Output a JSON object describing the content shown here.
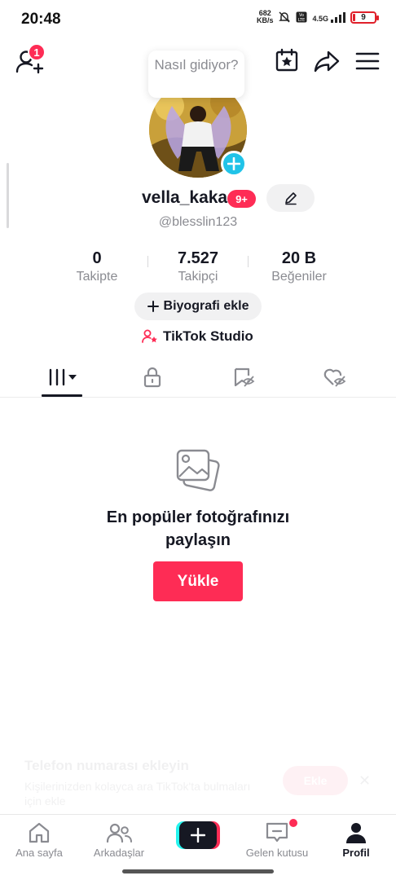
{
  "status_bar": {
    "time": "20:48",
    "net_speed_value": "682",
    "net_speed_unit": "KB/s",
    "network": "4.5G",
    "battery_level": "9",
    "battery_color": "#e0202a"
  },
  "top_bar": {
    "add_friend_badge": "1",
    "icons": [
      "add-friend-icon",
      "calendar-star-icon",
      "share-icon",
      "menu-icon"
    ]
  },
  "profile": {
    "status_bubble": "Nasıl gidiyor?",
    "username": "vella_kaka",
    "notification_badge": "9+",
    "handle": "@blesslin123"
  },
  "stats": [
    {
      "value": "0",
      "label": "Takipte"
    },
    {
      "value": "7.527",
      "label": "Takipçi"
    },
    {
      "value": "20 B",
      "label": "Beğeniler"
    }
  ],
  "actions": {
    "add_bio": "Biyografi ekle",
    "studio": "TikTok Studio"
  },
  "tabs": [
    "videos-grid-tab",
    "private-tab",
    "reposts-tab",
    "liked-tab"
  ],
  "empty_state": {
    "title": "En popüler fotoğrafınızı paylaşın",
    "upload_button": "Yükle"
  },
  "phone_banner": {
    "title": "Telefon numarası ekleyin",
    "description": "Kişilerinizden kolayca ara TikTok'ta bulmaları için ekle",
    "button": "Ekle"
  },
  "bottom_nav": [
    {
      "label": "Ana sayfa",
      "icon": "home-icon"
    },
    {
      "label": "Arkadaşlar",
      "icon": "friends-icon"
    },
    {
      "label": "",
      "icon": "create-icon"
    },
    {
      "label": "Gelen kutusu",
      "icon": "inbox-icon"
    },
    {
      "label": "Profil",
      "icon": "profile-icon"
    }
  ],
  "colors": {
    "accent": "#fe2c55",
    "cyan": "#25f4ee",
    "avatar_plus": "#20c3e8",
    "text": "#161823",
    "muted": "#8a8b91"
  }
}
